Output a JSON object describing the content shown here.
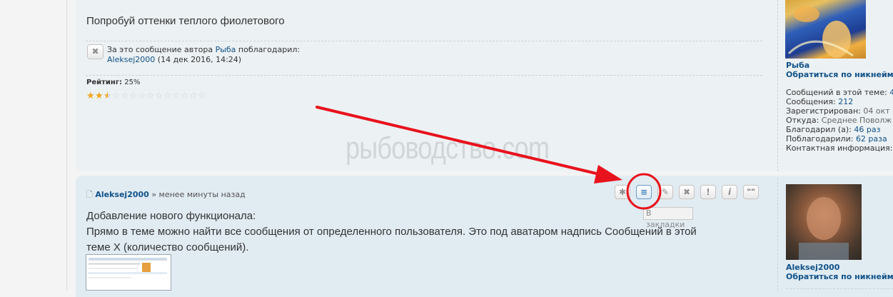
{
  "post1": {
    "text": "Попробуй оттенки теплого фиолетового",
    "thanks": {
      "prefix": "За это сообщение автора",
      "author": "Рыба",
      "suffix": "поблагодарил:",
      "user": "Aleksej2000",
      "date": "(14 дек 2016, 14:24)"
    },
    "rating": {
      "label": "Рейтинг:",
      "value": "25%",
      "stars_total": 14,
      "stars_filled": 2.5
    },
    "profile": {
      "name": "Рыба",
      "mention": "Обратиться по никнейм",
      "stats": [
        {
          "label": "Сообщений в этой теме:",
          "value": "4"
        },
        {
          "label": "Сообщения:",
          "value": "212"
        },
        {
          "label": "Зарегистрирован:",
          "value": "04 окт"
        },
        {
          "label": "Откуда:",
          "value": "Среднее Поволж"
        },
        {
          "label": "Благодарил (а):",
          "value": "46 раз"
        },
        {
          "label": "Поблагодарили:",
          "value": "62 раза"
        },
        {
          "label": "Контактная информация:",
          "value": ""
        }
      ]
    }
  },
  "watermark": "рыбоводство.com",
  "post2": {
    "author": "Aleksej2000",
    "time": "» менее минуты назад",
    "line1": "Добавление нового функционала:",
    "line2": "Прямо в теме можно найти все сообщения от определенного пользователя. Это под аватаром надпись Сообщений в этой",
    "line3": "теме Х (количество сообщений).",
    "tooltip": "В закладки",
    "buttons": [
      "✱",
      "≡",
      "✎",
      "✖",
      "!",
      "i",
      "❝❝"
    ],
    "profile": {
      "name": "Aleksej2000",
      "mention": "Обратиться по никнейм"
    }
  },
  "colors": {
    "link": "#105289",
    "annotation": "#e8121c",
    "star": "#f2a51a"
  }
}
